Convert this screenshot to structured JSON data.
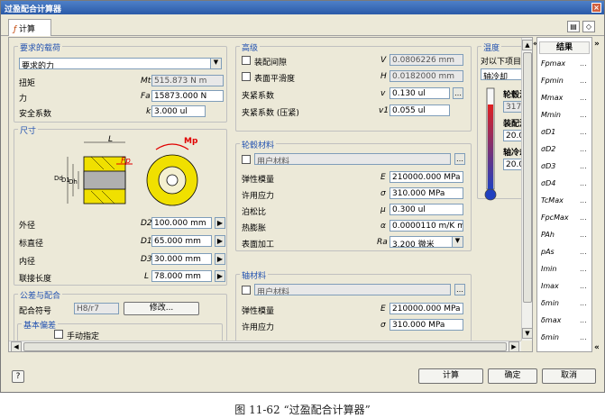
{
  "window": {
    "title": "过盈配合计算器",
    "close": "×"
  },
  "tab": {
    "label": "计算"
  },
  "load": {
    "group": "要求的载荷",
    "select": "要求的力",
    "torque_label": "扭矩",
    "torque_sym": "Mt",
    "torque_val": "515.873 N m",
    "force_label": "力",
    "force_sym": "Fa",
    "force_val": "15873.000 N",
    "safety_label": "安全系数",
    "safety_sym": "k",
    "safety_val": "3.000 ul"
  },
  "dims": {
    "group": "尺寸",
    "label_L": "L",
    "label_Mp": "Mp",
    "label_Fp": "Fp",
    "label_Dd": "Dd",
    "label_Di": "D1",
    "label_Dh": "Dh",
    "outer_label": "外径",
    "outer_sym": "D2",
    "outer_val": "100.000 mm",
    "nominal_label": "标直径",
    "nominal_sym": "D1",
    "nominal_val": "65.000 mm",
    "inner_label": "内径",
    "inner_sym": "D3",
    "inner_val": "30.000 mm",
    "length_label": "联接长度",
    "length_sym": "L",
    "length_val": "78.000 mm"
  },
  "fit": {
    "group": "公差与配合",
    "code_label": "配合符号",
    "code_val": "H8/r7",
    "modify_btn": "修改...",
    "sub_group": "基本偏差",
    "auto_label": "手动指定"
  },
  "props": {
    "group": "高级",
    "c1_label": "装配间隙",
    "c1_sym": "V",
    "c1_val": "0.0806226 mm",
    "c2_label": "表面平滑度",
    "c2_sym": "H",
    "c2_val": "0.0182000 mm",
    "f1_label": "夹紧系数",
    "f1_sym": "v",
    "f1_val": "0.130 ul",
    "f2_label": "夹紧系数 (压紧)",
    "f2_sym": "v1",
    "f2_val": "0.055 ul"
  },
  "hub": {
    "group": "轮毂材料",
    "user_label": "用户材料",
    "e_label": "弹性模量",
    "e_sym": "E",
    "e_val": "210000.000 MPa",
    "s_label": "许用应力",
    "s_sym": "σ",
    "s_val": "310.000 MPa",
    "p_label": "泊松比",
    "p_sym": "μ",
    "p_val": "0.300 ul",
    "a_label": "热膨胀",
    "a_sym": "α",
    "a_val": "0.0000110 m/K m",
    "r_label": "表面加工",
    "r_sym": "Ra",
    "r_val": "3.200 微米"
  },
  "shaft": {
    "group": "轴材料",
    "user_label": "用户材料",
    "e_label": "弹性模量",
    "e_sym": "E",
    "e_val": "210000.000 MPa",
    "s_label": "许用应力",
    "s_sym": "σ",
    "s_val": "310.000 MPa"
  },
  "temp": {
    "group": "温度",
    "opt_label": "对以下项目",
    "sel_val": "轴冷却",
    "hub_label": "轮毂温",
    "hub_val": "317.",
    "mount_label": "装配温",
    "mount_val": "20.0",
    "shaft_label": "轴冷却",
    "shaft_val": "20.0"
  },
  "results": {
    "header": "结果",
    "items": [
      "Fpmax",
      "Fpmin",
      "Mmax",
      "Mmin",
      "σD1",
      "σD2",
      "σD3",
      "σD4",
      "TcMax",
      "FpcMax",
      "PAh",
      "pAs",
      "Imin",
      "Imax",
      "δmin",
      "δmax",
      "δmin"
    ],
    "dots": "..."
  },
  "buttons": {
    "help": "?",
    "calc": "计算",
    "ok": "确定",
    "cancel": "取消",
    "collapse": "«",
    "expand": "»"
  },
  "caption": "图 11-62  “过盈配合计算器”"
}
